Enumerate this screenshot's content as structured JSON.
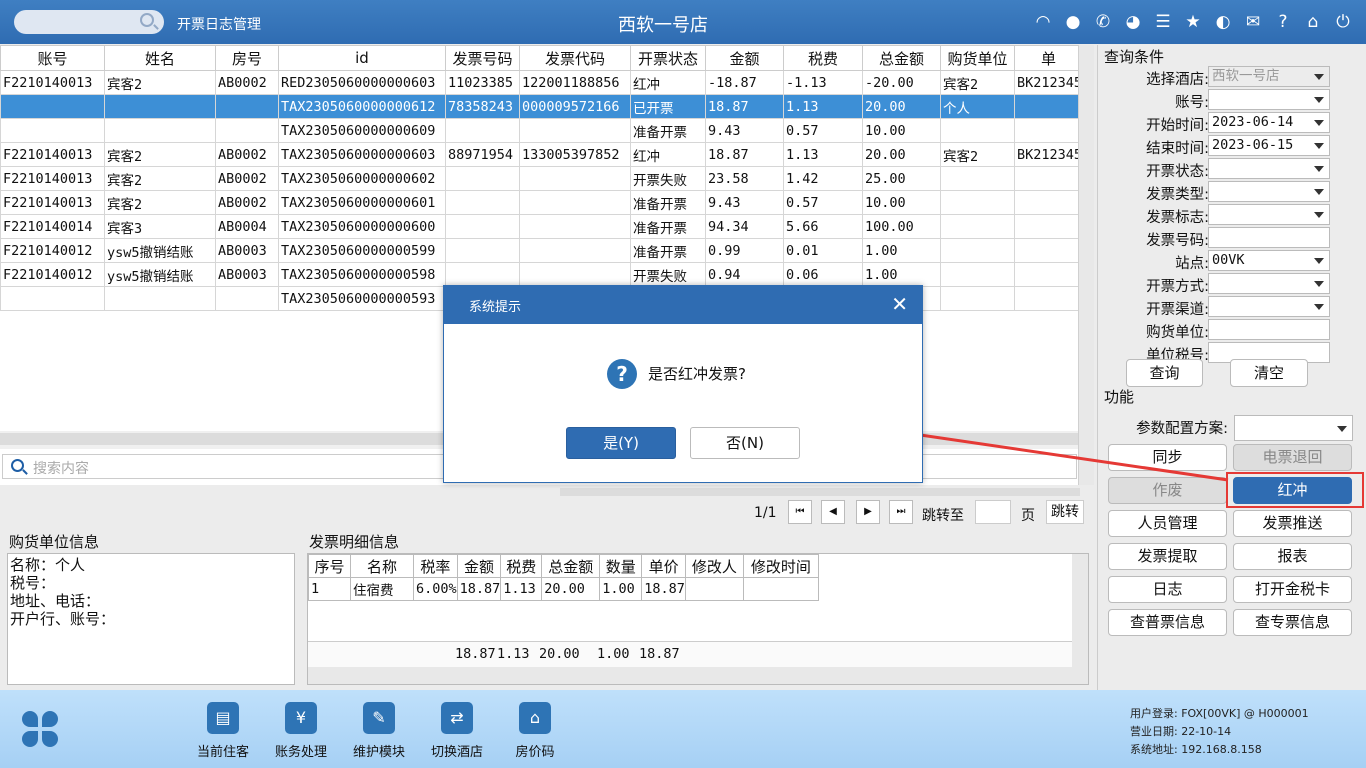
{
  "topbar": {
    "search_placeholder": "",
    "title": "开票日志管理",
    "store": "西软一号店",
    "icons": [
      "wifi-icon",
      "chat-icon",
      "phone-icon",
      "palette-icon",
      "menu-icon",
      "star-icon",
      "contrast-icon",
      "mail-icon",
      "help-icon",
      "home-icon",
      "power-icon"
    ]
  },
  "grid": {
    "columns": [
      "账号",
      "姓名",
      "房号",
      "id",
      "发票号码",
      "发票代码",
      "开票状态",
      "金额",
      "税费",
      "总金额",
      "购货单位",
      "单"
    ],
    "rows": [
      [
        "F2210140013",
        "宾客2",
        "AB0002",
        "RED2305060000000603",
        "11023385",
        "122001188856",
        "红冲",
        "-18.87",
        "-1.13",
        "-20.00",
        "宾客2",
        "BK212345"
      ],
      [
        "",
        "",
        "",
        "TAX2305060000000612",
        "78358243",
        "000009572166",
        "已开票",
        "18.87",
        "1.13",
        "20.00",
        "个人",
        ""
      ],
      [
        "",
        "",
        "",
        "TAX2305060000000609",
        "",
        "",
        "准备开票",
        "9.43",
        "0.57",
        "10.00",
        "",
        ""
      ],
      [
        "F2210140013",
        "宾客2",
        "AB0002",
        "TAX2305060000000603",
        "88971954",
        "133005397852",
        "红冲",
        "18.87",
        "1.13",
        "20.00",
        "宾客2",
        "BK212345"
      ],
      [
        "F2210140013",
        "宾客2",
        "AB0002",
        "TAX2305060000000602",
        "",
        "",
        "开票失败",
        "23.58",
        "1.42",
        "25.00",
        "",
        ""
      ],
      [
        "F2210140013",
        "宾客2",
        "AB0002",
        "TAX2305060000000601",
        "",
        "",
        "准备开票",
        "9.43",
        "0.57",
        "10.00",
        "",
        ""
      ],
      [
        "F2210140014",
        "宾客3",
        "AB0004",
        "TAX2305060000000600",
        "",
        "",
        "准备开票",
        "94.34",
        "5.66",
        "100.00",
        "",
        ""
      ],
      [
        "F2210140012",
        "ysw5撤销结账",
        "AB0003",
        "TAX2305060000000599",
        "",
        "",
        "准备开票",
        "0.99",
        "0.01",
        "1.00",
        "",
        ""
      ],
      [
        "F2210140012",
        "ysw5撤销结账",
        "AB0003",
        "TAX2305060000000598",
        "",
        "",
        "开票失败",
        "0.94",
        "0.06",
        "1.00",
        "",
        ""
      ],
      [
        "",
        "",
        "",
        "TAX2305060000000593",
        "",
        "",
        "",
        "",
        "",
        "",
        "",
        ""
      ]
    ],
    "selected_row": 1,
    "search_placeholder": "搜索内容"
  },
  "pager": {
    "info": "1/1",
    "jump_to": "跳转至",
    "page": "页",
    "jump": "跳转"
  },
  "buyer": {
    "title": "购货单位信息",
    "lines": [
      "名称：个人",
      "税号：",
      "地址、电话：",
      "开户行、账号："
    ]
  },
  "detail": {
    "title": "发票明细信息",
    "columns": [
      "序号",
      "名称",
      "税率",
      "金额",
      "税费",
      "总金额",
      "数量",
      "单价",
      "修改人",
      "修改时间"
    ],
    "rows": [
      [
        "1",
        "住宿费",
        "6.00%",
        "18.87",
        "1.13",
        "20.00",
        "1.00",
        "18.87",
        "",
        ""
      ]
    ],
    "totals": {
      "amount": "18.87",
      "tax": "1.13",
      "total": "20.00",
      "qty": "1.00",
      "price": "18.87"
    }
  },
  "query": {
    "title": "查询条件",
    "fields": [
      {
        "label": "选择酒店:",
        "value": "西软一号店",
        "dropdown": true,
        "disabled": true
      },
      {
        "label": "账号:",
        "value": "",
        "dropdown": true
      },
      {
        "label": "开始时间:",
        "value": "2023-06-14",
        "dropdown": true
      },
      {
        "label": "结束时间:",
        "value": "2023-06-15",
        "dropdown": true
      },
      {
        "label": "开票状态:",
        "value": "",
        "dropdown": true
      },
      {
        "label": "发票类型:",
        "value": "",
        "dropdown": true
      },
      {
        "label": "发票标志:",
        "value": "",
        "dropdown": true
      },
      {
        "label": "发票号码:",
        "value": "",
        "dropdown": false
      },
      {
        "label": "站点:",
        "value": "00VK",
        "dropdown": true
      },
      {
        "label": "开票方式:",
        "value": "",
        "dropdown": true
      },
      {
        "label": "开票渠道:",
        "value": "",
        "dropdown": true
      },
      {
        "label": "购货单位:",
        "value": "",
        "dropdown": false
      },
      {
        "label": "单位税号:",
        "value": "",
        "dropdown": false
      }
    ],
    "search": "查询",
    "clear": "清空"
  },
  "functions": {
    "title": "功能",
    "param_label": "参数配置方案:",
    "param_value": "",
    "buttons": [
      {
        "label": "同步",
        "state": "normal"
      },
      {
        "label": "电票退回",
        "state": "disabled"
      },
      {
        "label": "作废",
        "state": "disabled"
      },
      {
        "label": "红冲",
        "state": "active"
      },
      {
        "label": "人员管理",
        "state": "normal"
      },
      {
        "label": "发票推送",
        "state": "normal"
      },
      {
        "label": "发票提取",
        "state": "normal"
      },
      {
        "label": "报表",
        "state": "normal"
      },
      {
        "label": "日志",
        "state": "normal"
      },
      {
        "label": "打开金税卡",
        "state": "normal"
      },
      {
        "label": "查普票信息",
        "state": "normal"
      },
      {
        "label": "查专票信息",
        "state": "normal"
      }
    ]
  },
  "bottombar": {
    "items": [
      {
        "label": "当前住客",
        "icon": "guest-card-icon",
        "glyph": "▤"
      },
      {
        "label": "账务处理",
        "icon": "billing-icon",
        "glyph": "¥"
      },
      {
        "label": "维护模块",
        "icon": "wrench-icon",
        "glyph": "✎"
      },
      {
        "label": "切换酒店",
        "icon": "switch-icon",
        "glyph": "⇄"
      },
      {
        "label": "房价码",
        "icon": "house-icon",
        "glyph": "⌂"
      }
    ],
    "user_label": "用户登录:",
    "user": "FOX[00VK] @ H000001",
    "date_label": "营业日期:",
    "date": "22-10-14",
    "addr_label": "系统地址:",
    "addr": "192.168.8.158"
  },
  "dialog": {
    "title": "系统提示",
    "message": "是否红冲发票?",
    "yes": "是(Y)",
    "no": "否(N)"
  },
  "colors": {
    "primary": "#2f6cb2",
    "selected_row": "#3d8fd6",
    "highlight": "#e53935"
  }
}
